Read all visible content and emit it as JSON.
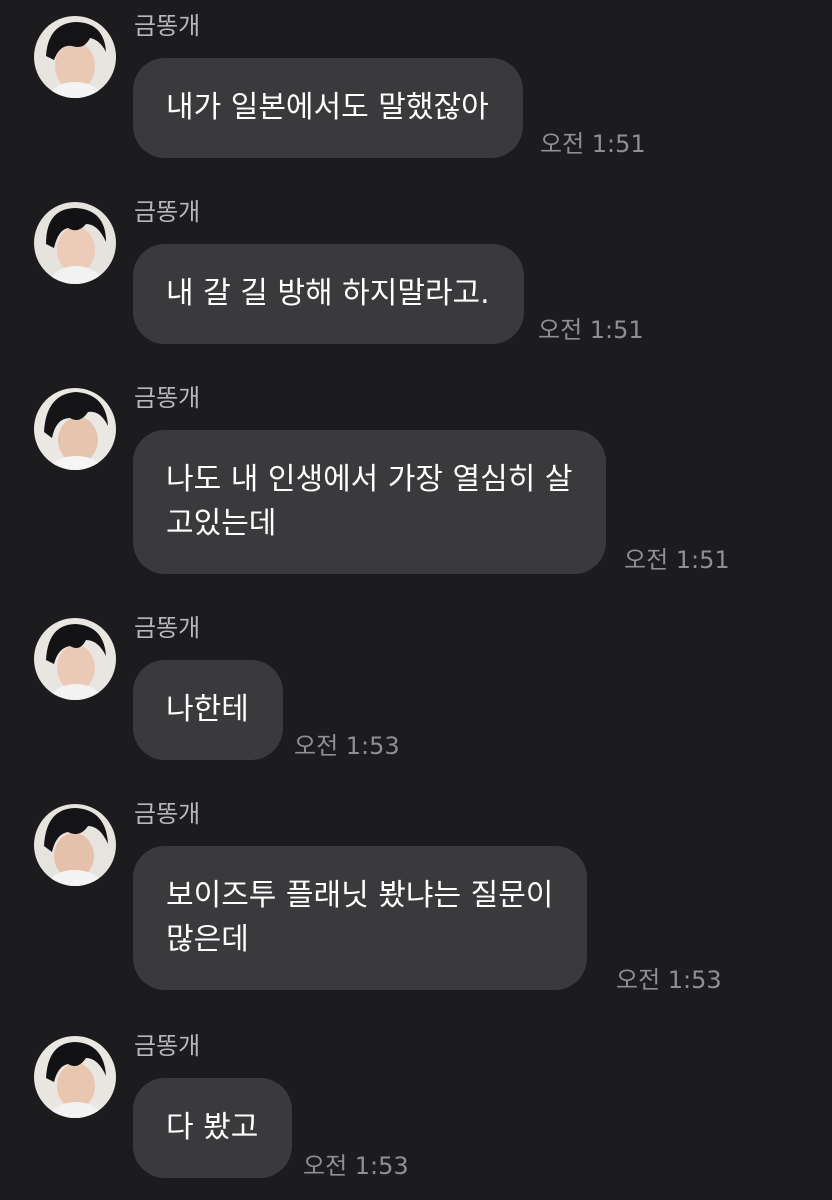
{
  "messages": [
    {
      "sender": "금똥개",
      "text": "내가 일본에서도 말했잖아",
      "time": "오전 1:51"
    },
    {
      "sender": "금똥개",
      "text": "내 갈 길 방해 하지말라고.",
      "time": "오전 1:51"
    },
    {
      "sender": "금똥개",
      "text": "나도 내 인생에서 가장 열심히 살\n고있는데",
      "time": "오전 1:51"
    },
    {
      "sender": "금똥개",
      "text": "나한테",
      "time": "오전 1:53"
    },
    {
      "sender": "금똥개",
      "text": "보이즈투 플래닛 봤냐는 질문이\n많은데",
      "time": "오전 1:53"
    },
    {
      "sender": "금똥개",
      "text": "다 봤고",
      "time": "오전 1:53"
    }
  ],
  "colors": {
    "background": "#1c1c1e",
    "bubble": "#3a3a3c",
    "sender_text": "#b8b8bc",
    "time_text": "#8e8e93"
  },
  "icons": {
    "avatar": "profile-photo"
  }
}
